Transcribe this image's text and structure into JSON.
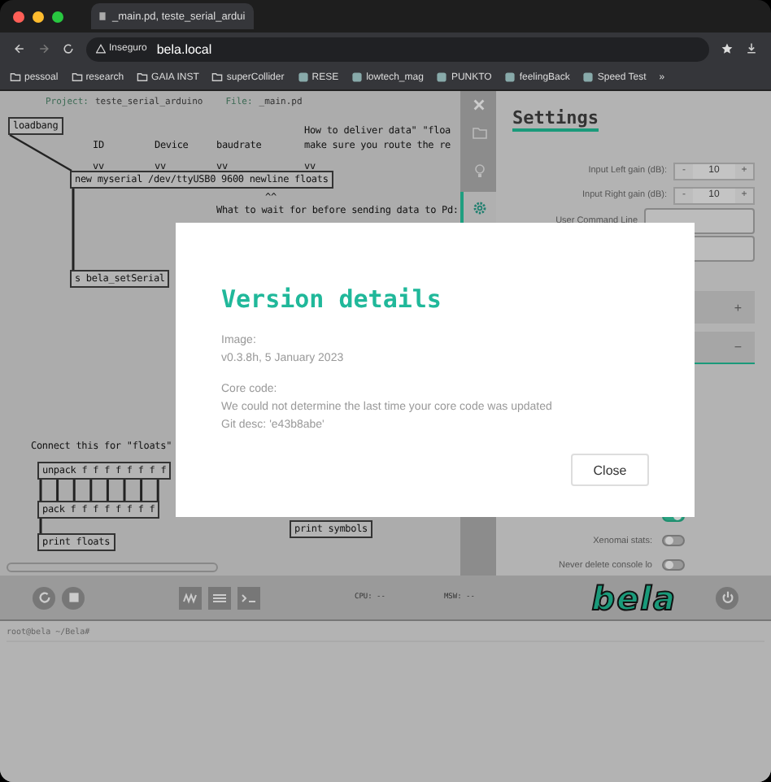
{
  "browser": {
    "tab_title": "_main.pd, teste_serial_ardui",
    "address": {
      "security": "Inseguro",
      "url": "bela.local"
    },
    "bookmarks": [
      {
        "kind": "folder",
        "label": "pessoal"
      },
      {
        "kind": "folder",
        "label": "research"
      },
      {
        "kind": "folder",
        "label": "GAIA INST"
      },
      {
        "kind": "folder",
        "label": "superCollider"
      },
      {
        "kind": "site",
        "label": "RESE"
      },
      {
        "kind": "site",
        "label": "lowtech_mag"
      },
      {
        "kind": "site",
        "label": "PUNKTO"
      },
      {
        "kind": "site",
        "label": "feelingBack"
      },
      {
        "kind": "site",
        "label": "Speed Test"
      }
    ],
    "more": "»"
  },
  "editor": {
    "project_label": "Project:",
    "project": "teste_serial_arduino",
    "file_label": "File:",
    "file": "_main.pd",
    "patch": [
      {
        "kind": "object",
        "text": "loadbang"
      },
      {
        "kind": "comment",
        "text": "How to deliver data\" \"floa"
      },
      {
        "kind": "comment",
        "text": "ID"
      },
      {
        "kind": "comment",
        "text": "Device"
      },
      {
        "kind": "comment",
        "text": "baudrate"
      },
      {
        "kind": "comment",
        "text": "make sure you route the re"
      },
      {
        "kind": "comment",
        "text": "vv"
      },
      {
        "kind": "comment",
        "text": "vv"
      },
      {
        "kind": "comment",
        "text": "vv"
      },
      {
        "kind": "comment",
        "text": "vv"
      },
      {
        "kind": "object",
        "text": "new myserial /dev/ttyUSB0 9600 newline floats"
      },
      {
        "kind": "comment",
        "text": "^^"
      },
      {
        "kind": "comment",
        "text": "What to wait for before sending data to Pd:"
      },
      {
        "kind": "object",
        "text": "s bela_setSerial"
      },
      {
        "kind": "comment",
        "text": "Connect this for \"floats\""
      },
      {
        "kind": "object",
        "text": "unpack f f f f f f f f"
      },
      {
        "kind": "object",
        "text": "pack f f f f f f f f"
      },
      {
        "kind": "object",
        "text": "print symbols"
      },
      {
        "kind": "object",
        "text": "print floats"
      }
    ]
  },
  "side_tabs": [
    {
      "kind": "files",
      "selected": false
    },
    {
      "kind": "ideas",
      "selected": false
    },
    {
      "kind": "settings",
      "selected": true
    }
  ],
  "settings": {
    "title": "Settings",
    "rows": [
      {
        "kind": "number",
        "label": "Input Left gain (dB):",
        "value": "10",
        "minus": "-",
        "plus": "+"
      },
      {
        "kind": "number",
        "label": "Input Right gain (dB):",
        "value": "10",
        "minus": "-",
        "plus": "+"
      },
      {
        "kind": "text",
        "label": "User Command Line"
      },
      {
        "kind": "text"
      }
    ],
    "sections": [
      {
        "sign": "+",
        "expanded": false
      },
      {
        "sign": "−",
        "expanded": true
      }
    ],
    "toggles": [
      {
        "on": true
      },
      {
        "label": "Xenomai stats:",
        "on": false
      },
      {
        "label": "Never delete console lo",
        "on": false
      }
    ]
  },
  "toolbar": {
    "cpu": "CPU: --",
    "msw": "MSW: --",
    "logo": "bela"
  },
  "console": {
    "prompt": "root@bela ~/Bela#"
  },
  "modal": {
    "title": "Version details",
    "sections": [
      {
        "heading": "Image:",
        "lines": [
          "v0.3.8h, 5 January 2023"
        ]
      },
      {
        "heading": "Core code:",
        "lines": [
          "We could not determine the last time your core code was updated",
          "Git desc: 'e43b8abe'"
        ]
      }
    ],
    "close": "Close"
  }
}
